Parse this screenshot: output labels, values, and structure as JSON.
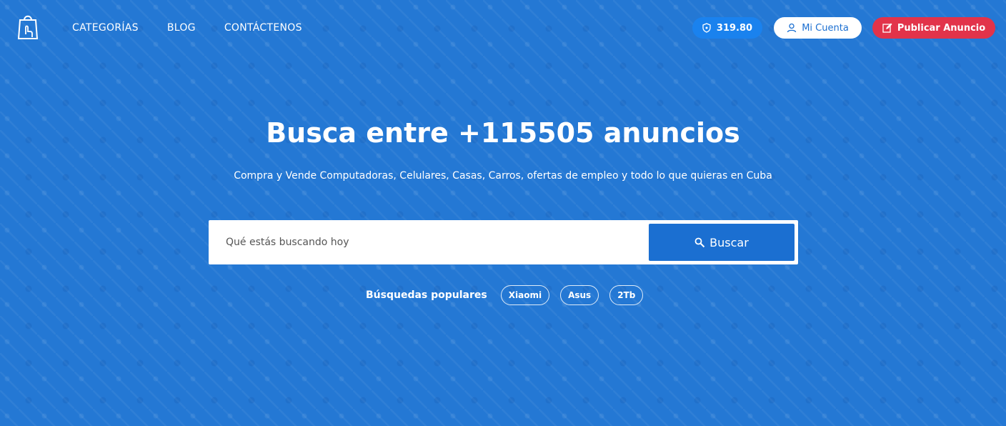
{
  "nav": {
    "items": [
      "CATEGORÍAS",
      "BLOG",
      "CONTÁCTENOS"
    ]
  },
  "header": {
    "credits": "319.80",
    "account_label": "Mi Cuenta",
    "publish_label": "Publicar Anuncio"
  },
  "hero": {
    "title": "Busca entre +115505 anuncios",
    "subtitle": "Compra y Vende Computadoras, Celulares, Casas, Carros, ofertas de empleo y todo lo que quieras en Cuba"
  },
  "search": {
    "placeholder": "Qué estás buscando hoy",
    "button_label": "Buscar"
  },
  "popular": {
    "label": "Búsquedas populares",
    "tags": [
      "Xiaomi",
      "Asus",
      "2Tb"
    ]
  },
  "colors": {
    "background": "#2478d4",
    "primary": "#1b6fd1",
    "accent_red": "#e2334a"
  }
}
